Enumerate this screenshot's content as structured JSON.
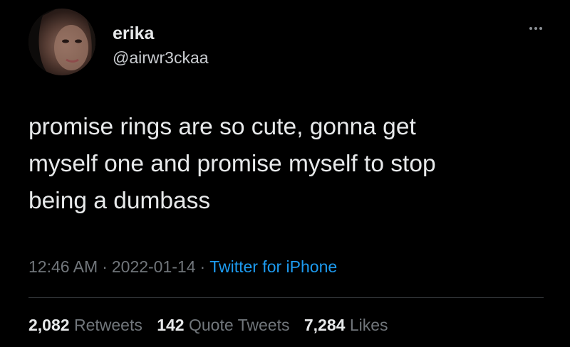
{
  "author": {
    "display_name": "erika",
    "handle": "@airwr3ckaa",
    "avatar_icon": "profile-photo"
  },
  "tweet": {
    "text": "promise rings are so cute, gonna get\nmyself one and promise myself to stop\nbeing a dumbass"
  },
  "meta": {
    "time": "12:46 AM",
    "separator": "·",
    "date": "2022-01-14",
    "source": "Twitter for iPhone"
  },
  "stats": {
    "retweets_count": "2,082",
    "retweets_label": "Retweets",
    "quotes_count": "142",
    "quotes_label": "Quote Tweets",
    "likes_count": "7,284",
    "likes_label": "Likes"
  },
  "colors": {
    "background": "#000000",
    "text": "#e7e9ea",
    "muted": "#71767b",
    "link": "#1d9bf0"
  }
}
